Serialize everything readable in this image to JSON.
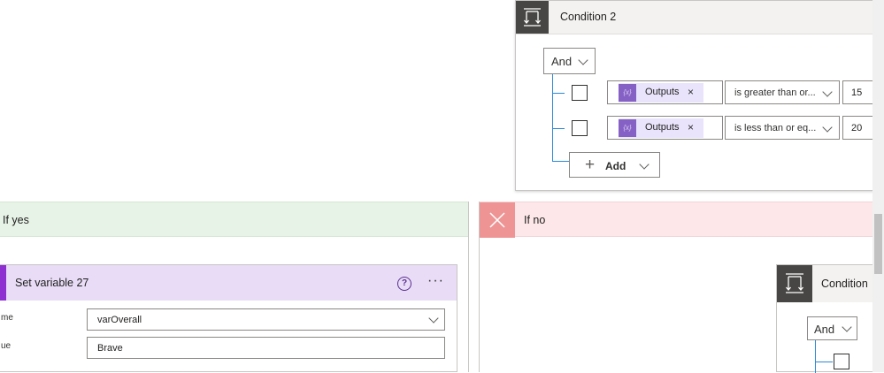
{
  "condition_card": {
    "title": "Condition 2",
    "group_operator": "And",
    "rows": [
      {
        "token_label": "Outputs",
        "token_remove": "×",
        "operator": "is greater than or...",
        "value": "15"
      },
      {
        "token_label": "Outputs",
        "token_remove": "×",
        "operator": "is less than or eq...",
        "value": "20"
      }
    ],
    "add_label": "Add",
    "add_symbol": "+",
    "token_icon_glyph": "{x}"
  },
  "branches": {
    "yes_title": "If yes",
    "no_title": "If no"
  },
  "set_variable_card": {
    "title": "Set variable 27",
    "help_glyph": "?",
    "more_glyph": "···",
    "name_label": "me",
    "name_value": "varOverall",
    "value_label": "ue",
    "value_value": "Brave"
  },
  "nested_condition": {
    "title": "Condition",
    "group_operator": "And"
  },
  "colors": {
    "yes_header": "#e7f3e6",
    "no_header": "#fde7e9",
    "set_variable_header": "#e8dcf6",
    "set_variable_accent": "#8e2fd1",
    "condition_icon_bg": "#484644",
    "tree_line": "#2b88d8",
    "token_bg": "#e9e4fb",
    "token_icon": "#8661c5"
  },
  "icons": {
    "condition": "condition-branch-icon",
    "no_branch": "close-x-icon",
    "token": "expression-variable-icon",
    "help": "help-circle-icon",
    "more": "ellipsis-icon"
  }
}
